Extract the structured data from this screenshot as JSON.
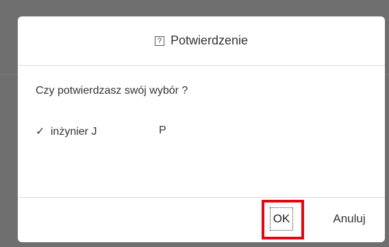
{
  "dialog": {
    "title": "Potwierdzenie",
    "title_icon": "help-icon",
    "title_icon_glyph": "?",
    "question": "Czy potwierdzasz swój wybór ?",
    "choice": {
      "check_glyph": "✓",
      "name": "inżynier J",
      "extra": "P"
    },
    "buttons": {
      "ok_label": "OK",
      "cancel_label": "Anuluj"
    }
  },
  "colors": {
    "backdrop": "#6f6f6f",
    "highlight": "#e30613"
  }
}
